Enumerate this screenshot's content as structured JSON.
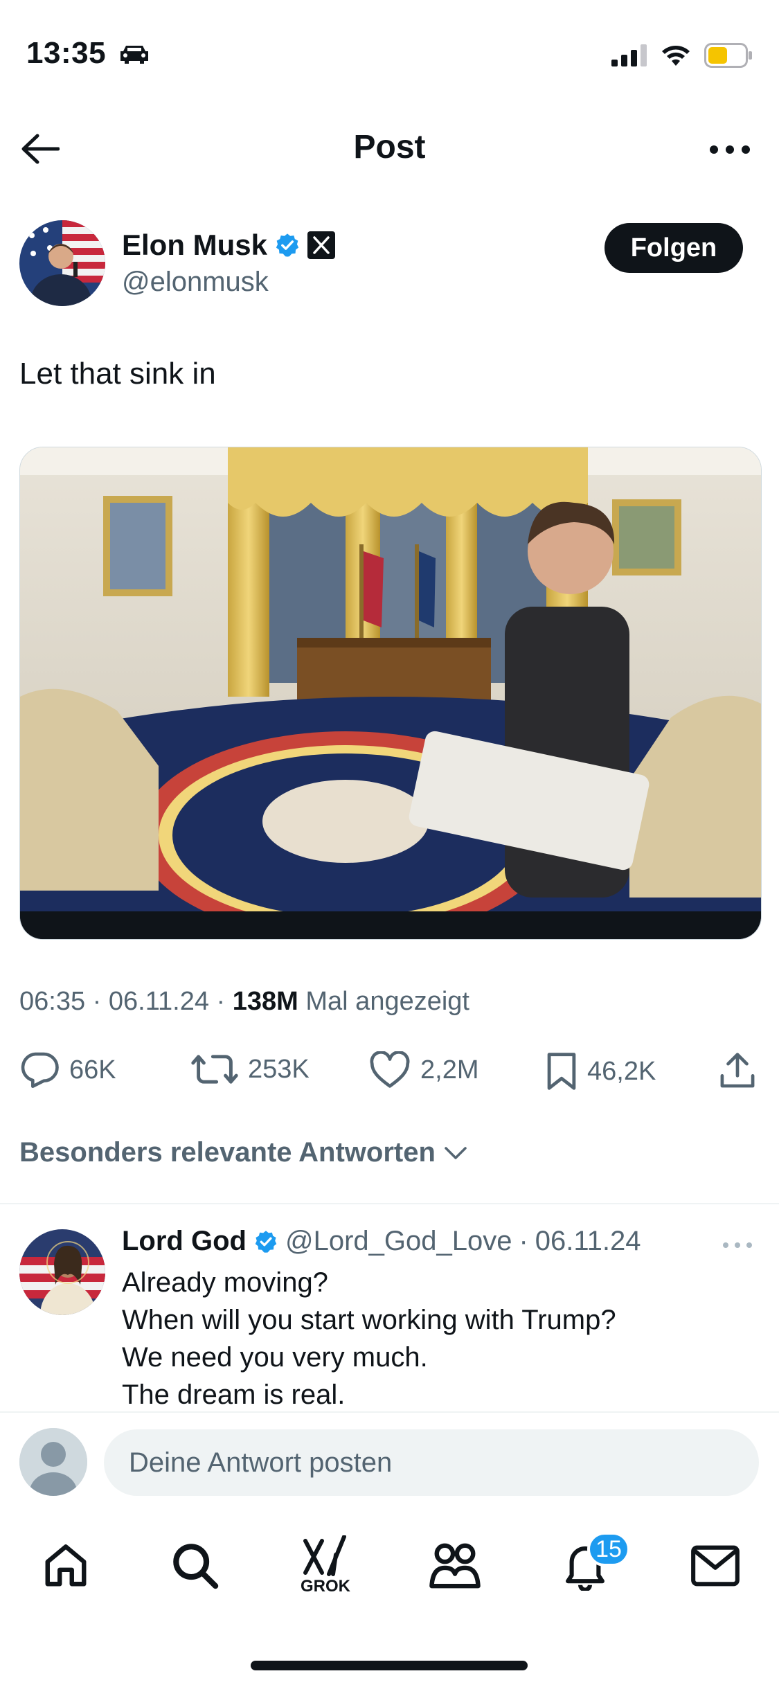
{
  "status_bar": {
    "time": "13:35"
  },
  "header": {
    "title": "Post"
  },
  "post": {
    "author_name": "Elon Musk",
    "author_handle": "@elonmusk",
    "follow_label": "Folgen",
    "text": "Let that sink in",
    "time": "06:35",
    "date": "06.11.24",
    "views_count": "138M",
    "views_label": "Mal angezeigt",
    "replies": "66K",
    "reposts": "253K",
    "likes": "2,2M",
    "bookmarks": "46,2K"
  },
  "sort": {
    "label": "Besonders relevante Antworten"
  },
  "reply": {
    "name": "Lord God",
    "handle": "@Lord_God_Love",
    "date": "06.11.24",
    "lines": [
      "Already moving?",
      "When will you start working with Trump?",
      "We need you very much.",
      "The dream is real."
    ]
  },
  "compose": {
    "placeholder": "Deine Antwort posten"
  },
  "tabbar": {
    "grok_label": "GROK",
    "notifications_badge": "15"
  },
  "colors": {
    "accent": "#1d9bf0",
    "text": "#0f1419",
    "secondary": "#536471"
  }
}
